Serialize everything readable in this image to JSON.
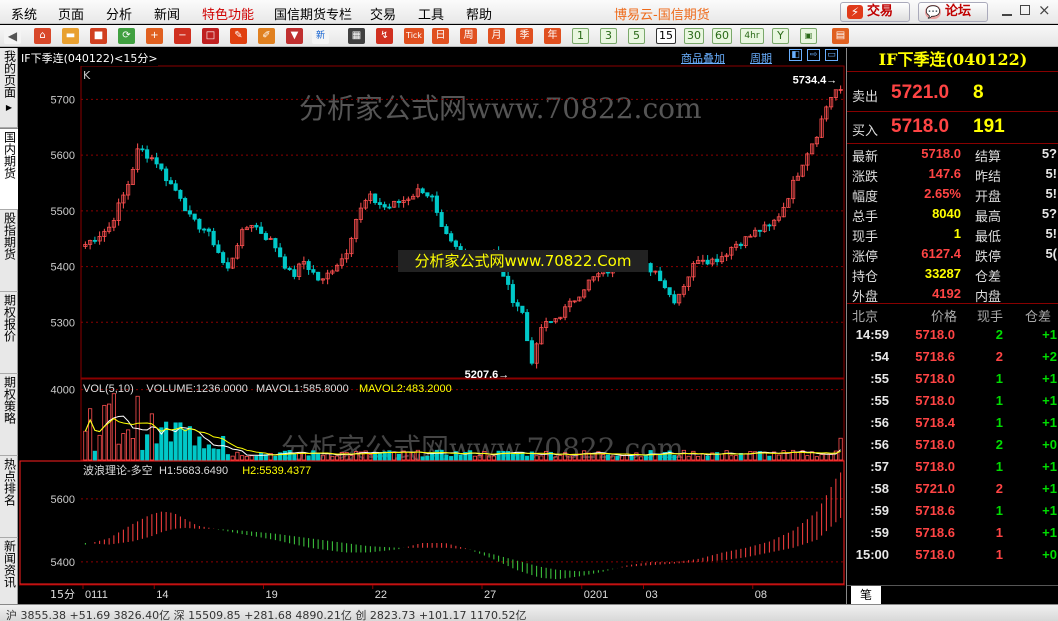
{
  "menu": [
    "系统",
    "页面",
    "分析",
    "新闻",
    "特色功能",
    "国信期货专栏",
    "交易",
    "工具",
    "帮助"
  ],
  "app_title": "博易云-国信期货",
  "top_buttons": {
    "trade": "交易",
    "forum": "论坛"
  },
  "toolbar": {
    "icon_names": [
      "back-icon",
      "home-icon",
      "folder-icon",
      "refresh-icon",
      "zoom-in-icon",
      "zoom-out-icon",
      "box-icon",
      "pen-icon",
      "draw-icon",
      "filter-icon",
      "new-icon",
      "table-icon",
      "chart-icon",
      "tick-icon"
    ],
    "tick_label": "Tick",
    "period_labels": [
      "日",
      "周",
      "月",
      "季"
    ],
    "minute_labels": [
      "1",
      "3",
      "5",
      "15",
      "30",
      "60",
      "4hr",
      "Y"
    ],
    "selected_period": "15"
  },
  "left_tabs": [
    "我的页面",
    "国内期货",
    "股指期货",
    "期权报价",
    "期权策略",
    "热点排名",
    "新闻资讯"
  ],
  "chart_header": {
    "title": "IF下季连(040122)<15分>",
    "overlay_link": "商品叠加",
    "period_link": "周期"
  },
  "watermarks": {
    "main": "分析家公式网www.70822.com",
    "center": "分析家公式网www.70822.Com"
  },
  "chart_data": [
    {
      "type": "candlestick",
      "panel": "main",
      "label": "K",
      "ylim": [
        5200,
        5760
      ],
      "yticks": [
        5300,
        5400,
        5500,
        5600,
        5700
      ],
      "annotations": [
        {
          "text": "5734.4",
          "value": 5734.4
        },
        {
          "text": "5207.6",
          "value": 5207.6
        }
      ],
      "colors": {
        "up": "#ff5050",
        "down": "#00c8c8"
      },
      "path": [
        [
          0,
          5440
        ],
        [
          4,
          5470
        ],
        [
          7,
          5540
        ],
        [
          9,
          5612
        ],
        [
          12,
          5590
        ],
        [
          13,
          5570
        ],
        [
          15,
          5540
        ],
        [
          16,
          5530
        ],
        [
          18,
          5480
        ],
        [
          20,
          5470
        ],
        [
          22,
          5440
        ],
        [
          24,
          5390
        ],
        [
          26,
          5450
        ],
        [
          28,
          5480
        ],
        [
          30,
          5460
        ],
        [
          32,
          5440
        ],
        [
          33,
          5420
        ],
        [
          35,
          5380
        ],
        [
          37,
          5410
        ],
        [
          40,
          5370
        ],
        [
          42,
          5400
        ],
        [
          44,
          5420
        ],
        [
          46,
          5490
        ],
        [
          48,
          5525
        ],
        [
          51,
          5505
        ],
        [
          54,
          5520
        ],
        [
          57,
          5540
        ],
        [
          59,
          5520
        ],
        [
          60,
          5470
        ],
        [
          62,
          5440
        ],
        [
          64,
          5420
        ],
        [
          66,
          5415
        ],
        [
          69,
          5425
        ],
        [
          70,
          5420
        ],
        [
          71,
          5380
        ],
        [
          72,
          5350
        ],
        [
          74,
          5320
        ],
        [
          75,
          5260
        ],
        [
          76,
          5220
        ],
        [
          77,
          5290
        ],
        [
          79,
          5300
        ],
        [
          82,
          5330
        ],
        [
          85,
          5370
        ],
        [
          87,
          5385
        ],
        [
          90,
          5400
        ],
        [
          92,
          5410
        ],
        [
          95,
          5400
        ],
        [
          97,
          5390
        ],
        [
          99,
          5350
        ],
        [
          100,
          5340
        ],
        [
          102,
          5380
        ],
        [
          104,
          5420
        ],
        [
          106,
          5410
        ],
        [
          108,
          5420
        ],
        [
          110,
          5440
        ],
        [
          112,
          5450
        ],
        [
          114,
          5465
        ],
        [
          116,
          5470
        ],
        [
          118,
          5500
        ],
        [
          120,
          5550
        ],
        [
          122,
          5600
        ],
        [
          124,
          5640
        ],
        [
          126,
          5700
        ],
        [
          128,
          5728
        ]
      ]
    },
    {
      "type": "bar",
      "panel": "volume",
      "header": [
        "VOL(5,10)",
        "VOLUME:1236.0000",
        "MAVOL1:585.8000",
        "MAVOL2:483.2000"
      ],
      "ylim": [
        0,
        4600
      ],
      "yticks": [
        4000
      ],
      "last_volume": 1236,
      "mavol1": 585.8,
      "mavol2": 483.2
    },
    {
      "type": "area",
      "panel": "indicator",
      "header": [
        "波浪理论-多空",
        "H1:5683.6490",
        "H2:5539.4377"
      ],
      "ylim": [
        5330,
        5720
      ],
      "yticks": [
        5400,
        5600
      ],
      "H1": 5683.649,
      "H2": 5539.4377,
      "colors": {
        "bull": "#ff4040",
        "bear": "#40d040"
      },
      "h1_path": [
        [
          0,
          5455
        ],
        [
          4,
          5475
        ],
        [
          8,
          5520
        ],
        [
          11,
          5550
        ],
        [
          13,
          5560
        ],
        [
          15,
          5555
        ],
        [
          17,
          5535
        ],
        [
          19,
          5515
        ],
        [
          22,
          5505
        ],
        [
          26,
          5490
        ],
        [
          32,
          5470
        ],
        [
          38,
          5445
        ],
        [
          44,
          5430
        ],
        [
          48,
          5430
        ],
        [
          53,
          5440
        ],
        [
          57,
          5460
        ],
        [
          61,
          5460
        ],
        [
          65,
          5440
        ],
        [
          69,
          5410
        ],
        [
          73,
          5375
        ],
        [
          77,
          5350
        ],
        [
          80,
          5345
        ],
        [
          84,
          5355
        ],
        [
          88,
          5370
        ],
        [
          92,
          5390
        ],
        [
          96,
          5400
        ],
        [
          100,
          5400
        ],
        [
          104,
          5410
        ],
        [
          108,
          5430
        ],
        [
          112,
          5445
        ],
        [
          116,
          5465
        ],
        [
          120,
          5500
        ],
        [
          124,
          5560
        ],
        [
          128,
          5690
        ]
      ],
      "h2_path": [
        [
          0,
          5460
        ],
        [
          4,
          5455
        ],
        [
          8,
          5465
        ],
        [
          11,
          5480
        ],
        [
          13,
          5495
        ],
        [
          15,
          5505
        ],
        [
          17,
          5508
        ],
        [
          19,
          5505
        ],
        [
          22,
          5505
        ],
        [
          26,
          5500
        ],
        [
          32,
          5490
        ],
        [
          38,
          5475
        ],
        [
          44,
          5460
        ],
        [
          48,
          5450
        ],
        [
          53,
          5445
        ],
        [
          57,
          5445
        ],
        [
          61,
          5445
        ],
        [
          65,
          5440
        ],
        [
          69,
          5425
        ],
        [
          73,
          5405
        ],
        [
          77,
          5385
        ],
        [
          80,
          5375
        ],
        [
          84,
          5370
        ],
        [
          88,
          5375
        ],
        [
          92,
          5385
        ],
        [
          96,
          5390
        ],
        [
          100,
          5395
        ],
        [
          104,
          5400
        ],
        [
          108,
          5405
        ],
        [
          112,
          5415
        ],
        [
          116,
          5430
        ],
        [
          120,
          5445
        ],
        [
          124,
          5470
        ],
        [
          128,
          5540
        ]
      ]
    }
  ],
  "x_axis": {
    "period_label": "15分",
    "labels": [
      {
        "text": "0111",
        "at": 0
      },
      {
        "text": "14",
        "at": 15
      },
      {
        "text": "19",
        "at": 38
      },
      {
        "text": "22",
        "at": 61
      },
      {
        "text": "27",
        "at": 84
      },
      {
        "text": "0201",
        "at": 105
      },
      {
        "text": "03",
        "at": 118
      },
      {
        "text": "08",
        "at": 141
      }
    ],
    "n": 160
  },
  "quote": {
    "title": "IF下季连(040122)",
    "ask": {
      "label": "卖出",
      "price": "5721.0",
      "volume": "8"
    },
    "bid": {
      "label": "买入",
      "price": "5718.0",
      "volume": "191"
    },
    "rows": [
      {
        "l1": "最新",
        "v1": "5718.0",
        "c1": "red",
        "l2": "结算",
        "v2": "5?"
      },
      {
        "l1": "涨跌",
        "v1": "147.6",
        "c1": "red",
        "l2": "昨结",
        "v2": "5!"
      },
      {
        "l1": "幅度",
        "v1": "2.65%",
        "c1": "red",
        "l2": "开盘",
        "v2": "5!"
      },
      {
        "l1": "总手",
        "v1": "8040",
        "c1": "yellow",
        "l2": "最高",
        "v2": "5?"
      },
      {
        "l1": "现手",
        "v1": "1",
        "c1": "yellow",
        "l2": "最低",
        "v2": "5!"
      },
      {
        "l1": "涨停",
        "v1": "6127.4",
        "c1": "red",
        "l2": "跌停",
        "v2": "5("
      },
      {
        "l1": "持仓",
        "v1": "33287",
        "c1": "yellow",
        "l2": "仓差",
        "v2": ""
      },
      {
        "l1": "外盘",
        "v1": "4192",
        "c1": "red",
        "l2": "内盘",
        "v2": ""
      }
    ],
    "trade_header": [
      "北京",
      "价格",
      "现手",
      "仓差"
    ],
    "trades": [
      {
        "time": "14:59",
        "price": "5718.0",
        "qty": "2",
        "qc": "green",
        "oi": "+1"
      },
      {
        "time": ":54",
        "price": "5718.6",
        "qty": "2",
        "qc": "red",
        "oi": "+2"
      },
      {
        "time": ":55",
        "price": "5718.0",
        "qty": "1",
        "qc": "green",
        "oi": "+1"
      },
      {
        "time": ":55",
        "price": "5718.0",
        "qty": "1",
        "qc": "green",
        "oi": "+1"
      },
      {
        "time": ":56",
        "price": "5718.4",
        "qty": "1",
        "qc": "green",
        "oi": "+1"
      },
      {
        "time": ":56",
        "price": "5718.0",
        "qty": "2",
        "qc": "green",
        "oi": "+0"
      },
      {
        "time": ":57",
        "price": "5718.0",
        "qty": "1",
        "qc": "green",
        "oi": "+1"
      },
      {
        "time": ":58",
        "price": "5721.0",
        "qty": "2",
        "qc": "red",
        "oi": "+1"
      },
      {
        "time": ":59",
        "price": "5718.6",
        "qty": "1",
        "qc": "green",
        "oi": "+1"
      },
      {
        "time": ":59",
        "price": "5718.6",
        "qty": "1",
        "qc": "red",
        "oi": "+1"
      },
      {
        "time": "15:00",
        "price": "5718.0",
        "qty": "1",
        "qc": "red",
        "oi": "+0"
      }
    ],
    "bottom_tab": "笔"
  },
  "status_bar": "沪 3855.38 +51.69 3826.40亿 深 15509.85 +281.68 4890.21亿 创 2823.73 +101.17 1170.52亿"
}
